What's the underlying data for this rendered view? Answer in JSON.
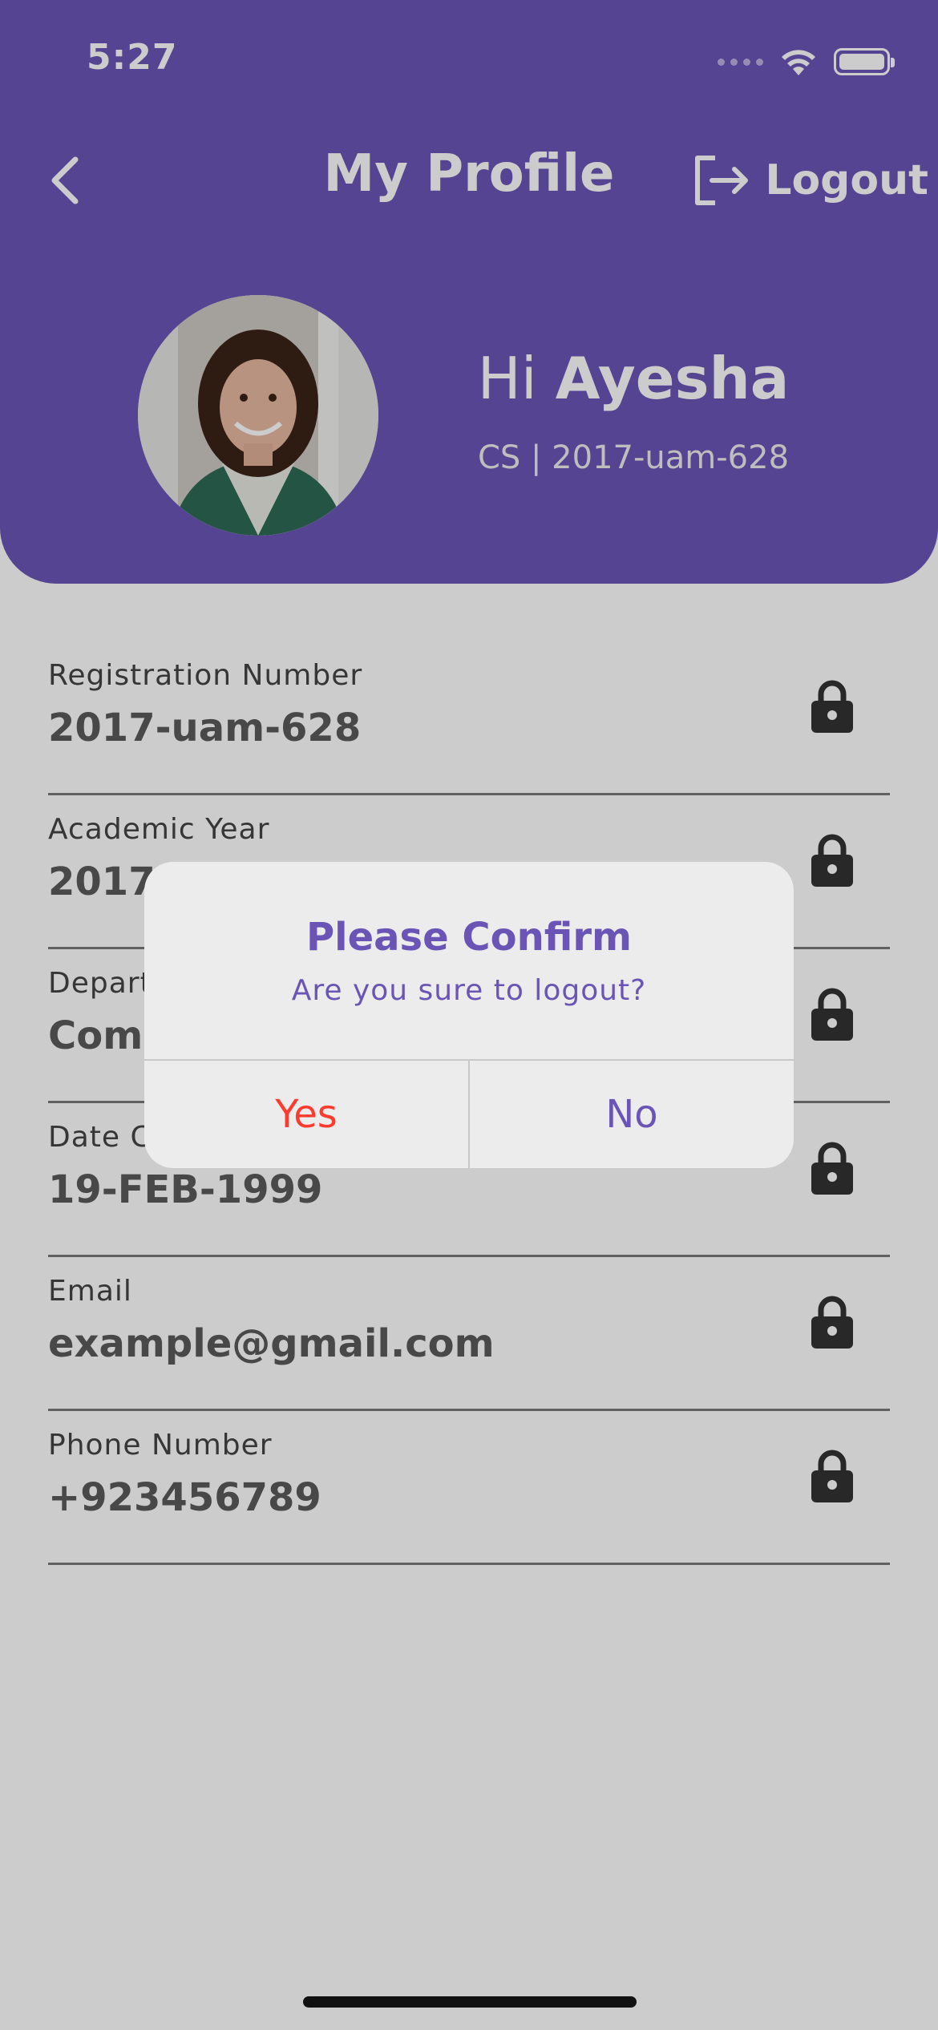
{
  "status_bar": {
    "time": "5:27"
  },
  "nav": {
    "title": "My Profile",
    "logout_label": "Logout"
  },
  "profile": {
    "greeting_prefix": "Hi",
    "name": "Ayesha",
    "subtitle": "CS | 2017-uam-628"
  },
  "fields": [
    {
      "label": "Registration Number",
      "value": "2017-uam-628"
    },
    {
      "label": "Academic Year",
      "value": "2017-"
    },
    {
      "label": "Depart",
      "value": "Com"
    },
    {
      "label": "Date C",
      "value": "19-FEB-1999"
    },
    {
      "label": "Email",
      "value": "example@gmail.com"
    },
    {
      "label": "Phone Number",
      "value": "+923456789"
    }
  ],
  "dialog": {
    "title": "Please Confirm",
    "message": "Are you sure to logout?",
    "yes_label": "Yes",
    "no_label": "No"
  },
  "colors": {
    "accent": "#6a55b6",
    "danger": "#ff3b30"
  }
}
